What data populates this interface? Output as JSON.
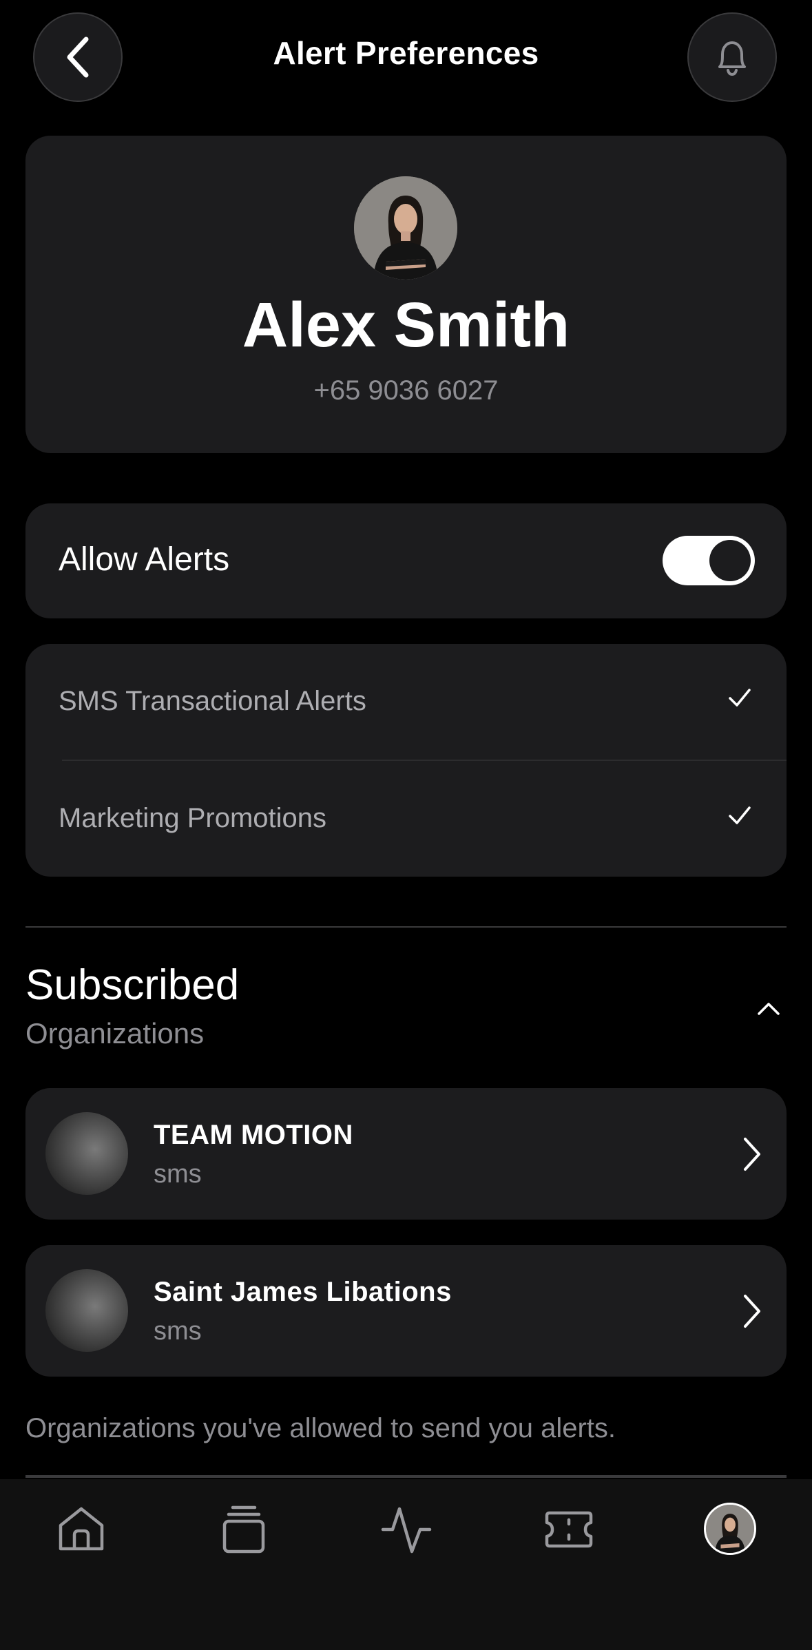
{
  "header": {
    "title": "Alert Preferences",
    "back_icon": "chevron-left-icon",
    "bell_icon": "bell-icon"
  },
  "profile": {
    "name": "Alex Smith",
    "phone": "+65 9036 6027",
    "avatar_icon": "user-avatar"
  },
  "allow_alerts": {
    "label": "Allow Alerts",
    "enabled": true
  },
  "options": [
    {
      "label": "SMS Transactional Alerts",
      "checked": true
    },
    {
      "label": "Marketing Promotions",
      "checked": true
    }
  ],
  "subscribed": {
    "title": "Subscribed",
    "subtitle": "Organizations",
    "expanded": true,
    "orgs": [
      {
        "name": "TEAM MOTION",
        "type": "sms"
      },
      {
        "name": "Saint James Libations",
        "type": "sms"
      }
    ],
    "footnote": "Organizations you've allowed to send you alerts."
  },
  "tabbar": {
    "items": [
      "home-icon",
      "cards-icon",
      "activity-icon",
      "ticket-icon",
      "profile-avatar"
    ]
  },
  "colors": {
    "background": "#000000",
    "card": "#1c1c1e",
    "muted_text": "#8e8e93"
  }
}
